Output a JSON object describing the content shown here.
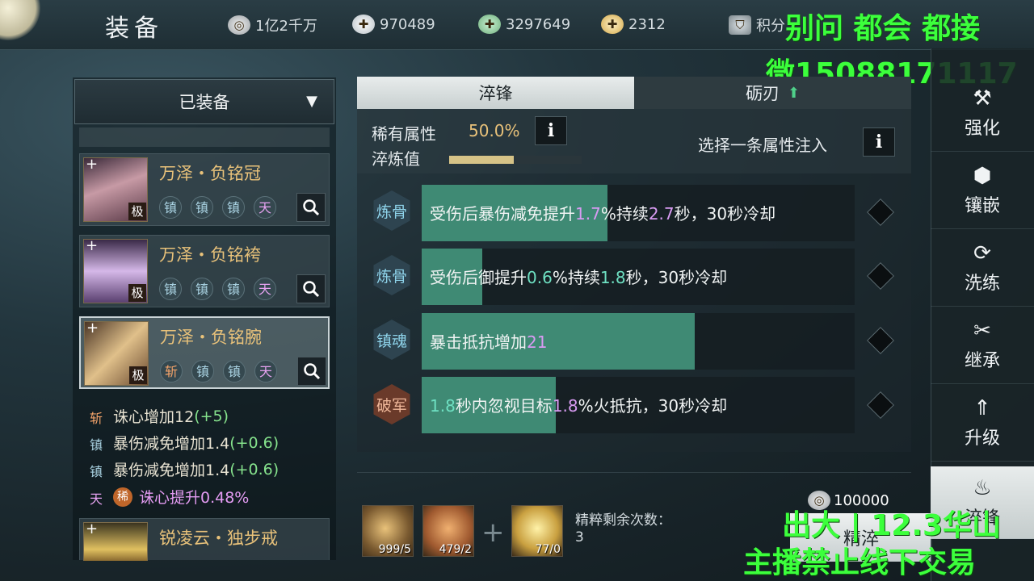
{
  "header": {
    "title": "装备",
    "currencies": [
      {
        "icon": "silver-coin-icon",
        "value": "1亿2千万"
      },
      {
        "icon": "ingot-plus-icon",
        "value": "970489"
      },
      {
        "icon": "jade-plus-icon",
        "value": "3297649"
      },
      {
        "icon": "gold-ingot-plus-icon",
        "value": "2312"
      },
      {
        "icon": "points-shield-icon",
        "value": "积分"
      }
    ]
  },
  "watermark": {
    "line1": "别问 都会 都接",
    "line2": "微15088171117",
    "line3": "出大 | 12.3华山",
    "line4": "主播禁止线下交易"
  },
  "left": {
    "dropdown_label": "已装备",
    "items": [
      {
        "name": "万泽・负铭冠",
        "rank": "极",
        "gems": [
          "镇",
          "镇",
          "镇",
          "天"
        ]
      },
      {
        "name": "万泽・负铭袴",
        "rank": "极",
        "gems": [
          "镇",
          "镇",
          "镇",
          "天"
        ]
      },
      {
        "name": "万泽・负铭腕",
        "rank": "极",
        "gems": [
          "斩",
          "镇",
          "镇",
          "天"
        ]
      },
      {
        "name": "锐凌云・独步戒",
        "rank": "",
        "gems": []
      }
    ],
    "attributes": [
      {
        "tag": "斩",
        "text": "诛心增加12",
        "bonus": "(+5)"
      },
      {
        "tag": "镇",
        "text": "暴伤减免增加1.4",
        "bonus": "(+0.6)"
      },
      {
        "tag": "镇",
        "text": "暴伤减免增加1.4",
        "bonus": "(+0.6)"
      },
      {
        "tag": "天",
        "badge": "稀",
        "text": "诛心提升0.48%",
        "bonus": ""
      }
    ]
  },
  "center": {
    "tabs": [
      {
        "label": "淬锋",
        "active": true
      },
      {
        "label": "砺刃",
        "active": false
      }
    ],
    "rare_label": "稀有属性",
    "rare_value": "50.0%",
    "quench_label": "淬炼值",
    "quench_progress": 0.49,
    "inject_label": "选择一条属性注入",
    "rows": [
      {
        "type": "炼骨",
        "fill": 0.43,
        "p1": "受伤后暴伤减免提升",
        "n1": "1.7",
        "p2": "%持续",
        "n2": "2.7",
        "p3": "秒，30秒冷却"
      },
      {
        "type": "炼骨",
        "fill": 0.14,
        "p1": "受伤后御提升",
        "n1": "0.6",
        "p2": "%持续",
        "n2": "1.8",
        "p3": "秒，30秒冷却"
      },
      {
        "type": "镇魂",
        "fill": 0.63,
        "p1": "暴击抵抗增加",
        "n1": "21",
        "p2": "",
        "n2": "",
        "p3": ""
      },
      {
        "type": "破军",
        "fill": 0.31,
        "p1": "",
        "n1": "1.8",
        "p2": "秒内忽视目标",
        "n2": "1.8",
        "p3": "%火抵抗，30秒冷却"
      }
    ],
    "materials": [
      {
        "count": "999/5"
      },
      {
        "count": "479/2"
      },
      {
        "count": "77/0"
      }
    ],
    "remaining_label": "精粹剩余次数：",
    "remaining_value": "3",
    "cost": "100000",
    "refine_button": "精淬"
  },
  "side_menu": [
    {
      "icon": "hammer-icon",
      "label": "强化"
    },
    {
      "icon": "hexagon-gem-icon",
      "label": "镶嵌"
    },
    {
      "icon": "refresh-icon",
      "label": "洗练"
    },
    {
      "icon": "inherit-icon",
      "label": "继承"
    },
    {
      "icon": "upgrade-arrows-icon",
      "label": "升级"
    },
    {
      "icon": "flame-blade-icon",
      "label": "淬锋",
      "active": true
    }
  ]
}
